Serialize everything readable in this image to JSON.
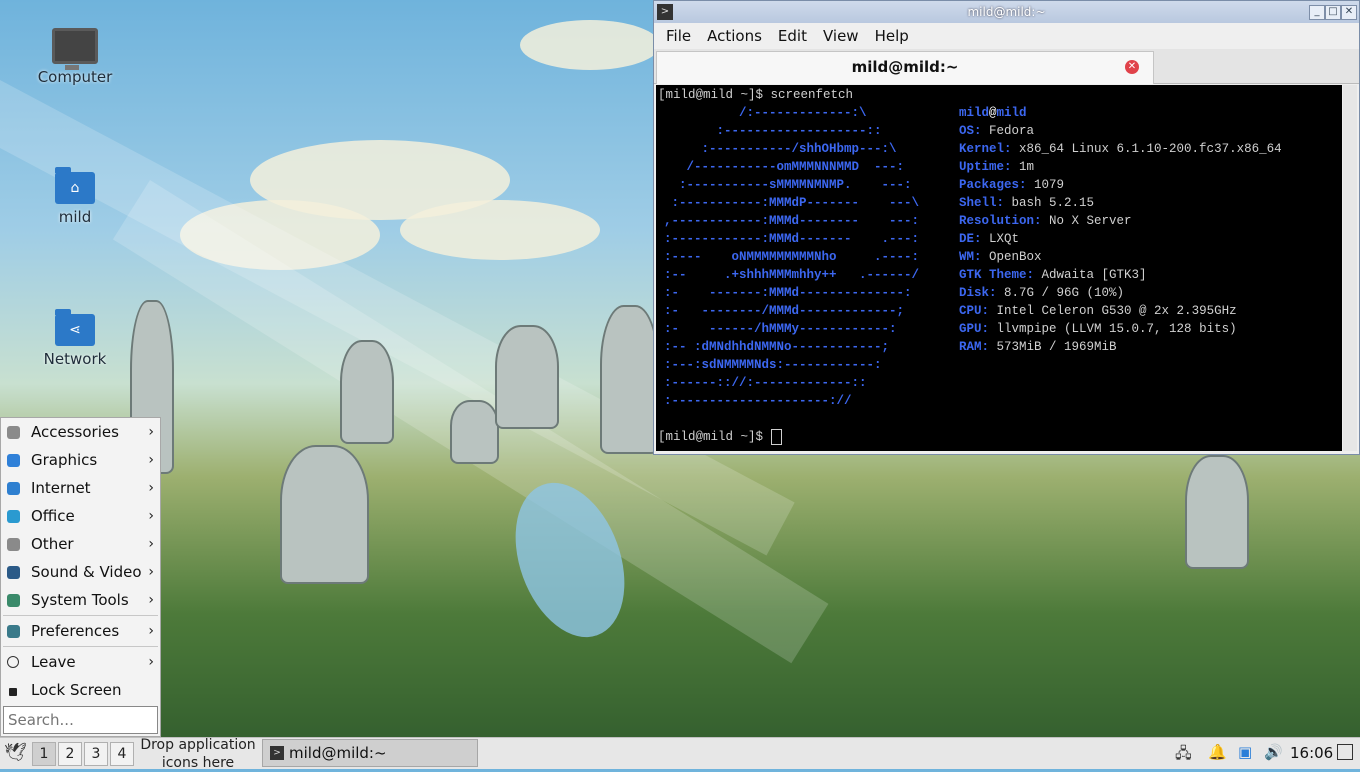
{
  "desktop": {
    "icons": [
      {
        "label": "Computer",
        "icon": "computer-icon"
      },
      {
        "label": "mild",
        "icon": "home-folder-icon"
      },
      {
        "label": "Network",
        "icon": "network-folder-icon"
      }
    ]
  },
  "terminal": {
    "window_title": "mild@mild:~",
    "menu": [
      "File",
      "Actions",
      "Edit",
      "View",
      "Help"
    ],
    "tab_title": "mild@mild:~",
    "prompt1": "[mild@mild ~]$ screenfetch",
    "prompt2": "[mild@mild ~]$ ",
    "logo_lines": [
      "          /:-------------:\\",
      "       :-------------------::",
      "     :-----------/shhOHbmp---:\\",
      "   /-----------omMMMNNNMMD  ---:",
      "  :-----------sMMMMNMNMP.    ---:",
      " :-----------:MMMdP-------    ---\\",
      ",------------:MMMd--------    ---:",
      ":------------:MMMd-------    .---:",
      ":----    oNMMMMMMMMMNho     .----:",
      ":--     .+shhhMMMmhhy++   .------/",
      ":-    -------:MMMd--------------:",
      ":-   --------/MMMd-------------;",
      ":-    ------/hMMMy------------:",
      ":-- :dMNdhhdNMMNo------------;",
      ":---:sdNMMMMNds:------------:",
      ":------:://:-------------::",
      ":---------------------://"
    ],
    "info_header": {
      "user": "mild",
      "at": "@",
      "host": "mild"
    },
    "info": [
      {
        "key": "OS:",
        "value": "Fedora"
      },
      {
        "key": "Kernel:",
        "value": "x86_64 Linux 6.1.10-200.fc37.x86_64"
      },
      {
        "key": "Uptime:",
        "value": "1m"
      },
      {
        "key": "Packages:",
        "value": "1079"
      },
      {
        "key": "Shell:",
        "value": "bash 5.2.15"
      },
      {
        "key": "Resolution:",
        "value": "No X Server"
      },
      {
        "key": "DE:",
        "value": "LXQt"
      },
      {
        "key": "WM:",
        "value": "OpenBox"
      },
      {
        "key": "GTK Theme:",
        "value": "Adwaita [GTK3]"
      },
      {
        "key": "Disk:",
        "value": "8.7G / 96G (10%)"
      },
      {
        "key": "CPU:",
        "value": "Intel Celeron G530 @ 2x 2.395GHz"
      },
      {
        "key": "GPU:",
        "value": "llvmpipe (LLVM 15.0.7, 128 bits)"
      },
      {
        "key": "RAM:",
        "value": "573MiB / 1969MiB"
      }
    ]
  },
  "start_menu": {
    "items": [
      {
        "label": "Accessories",
        "icon": "accessories-icon",
        "submenu": true,
        "color": "#8a8a8a"
      },
      {
        "label": "Graphics",
        "icon": "graphics-icon",
        "submenu": true,
        "color": "#2f80d8"
      },
      {
        "label": "Internet",
        "icon": "internet-icon",
        "submenu": true,
        "color": "#2e7fd0"
      },
      {
        "label": "Office",
        "icon": "office-icon",
        "submenu": true,
        "color": "#2a9ad0"
      },
      {
        "label": "Other",
        "icon": "other-icon",
        "submenu": true,
        "color": "#8a8a8a"
      },
      {
        "label": "Sound & Video",
        "icon": "sound-video-icon",
        "submenu": true,
        "color": "#2b5a87"
      },
      {
        "label": "System Tools",
        "icon": "system-tools-icon",
        "submenu": true,
        "color": "#3a8a6a"
      }
    ],
    "preferences": {
      "label": "Preferences",
      "icon": "preferences-icon"
    },
    "leave": {
      "label": "Leave",
      "icon": "power-icon"
    },
    "lock": {
      "label": "Lock Screen",
      "icon": "lock-icon"
    },
    "search_placeholder": "Search..."
  },
  "taskbar": {
    "workspaces": [
      "1",
      "2",
      "3",
      "4"
    ],
    "active_workspace": "1",
    "drop_text_1": "Drop application",
    "drop_text_2": "icons here",
    "task_label": "mild@mild:~",
    "clock": "16:06"
  }
}
